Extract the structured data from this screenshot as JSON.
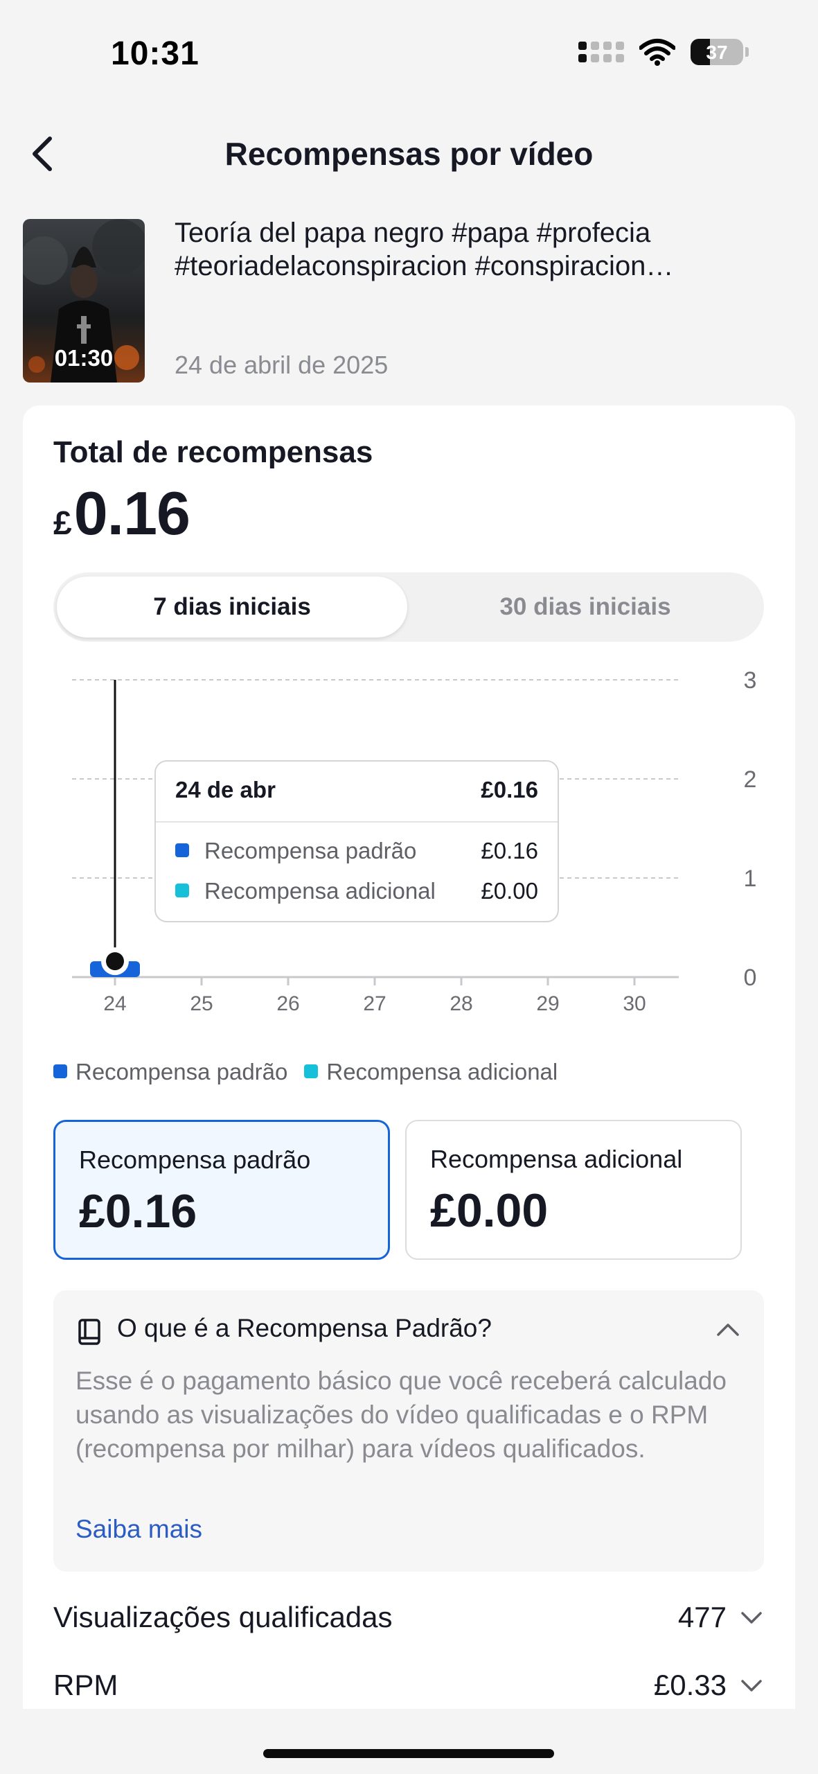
{
  "status_bar": {
    "time": "10:31",
    "battery": "37",
    "battery_level": 0.37
  },
  "header": {
    "title": "Recompensas por vídeo"
  },
  "video": {
    "duration": "01:30",
    "title": "Teoría del papa negro #papa #profecia #teoriadelaconspiracion #conspiracion…",
    "date": "24 de abril de 2025"
  },
  "total": {
    "label": "Total de recompensas",
    "currency": "£",
    "amount": "0.16"
  },
  "tabs": [
    {
      "label": "7 dias iniciais",
      "active": true
    },
    {
      "label": "30 dias iniciais",
      "active": false
    }
  ],
  "chart_data": {
    "type": "bar",
    "categories": [
      "24",
      "25",
      "26",
      "27",
      "28",
      "29",
      "30"
    ],
    "series": [
      {
        "name": "Recompensa padrão",
        "color": "#1664d9",
        "values": [
          0.16,
          0,
          0,
          0,
          0,
          0,
          0
        ]
      },
      {
        "name": "Recompensa adicional",
        "color": "#17c0d9",
        "values": [
          0.0,
          0,
          0,
          0,
          0,
          0,
          0
        ]
      }
    ],
    "ylim": [
      0,
      3
    ],
    "yticks": [
      "0",
      "1",
      "2",
      "3"
    ],
    "grid": true,
    "selected_category": "24"
  },
  "tooltip": {
    "date": "24 de abr",
    "total": "£0.16",
    "rows": [
      {
        "label": "Recompensa padrão",
        "value": "£0.16",
        "color": "#1664d9"
      },
      {
        "label": "Recompensa adicional",
        "value": "£0.00",
        "color": "#17c0d9"
      }
    ]
  },
  "legend": [
    {
      "label": "Recompensa padrão",
      "color": "#1664d9"
    },
    {
      "label": "Recompensa adicional",
      "color": "#17c0d9"
    }
  ],
  "boxes": [
    {
      "label": "Recompensa padrão",
      "value": "£0.16",
      "selected": true
    },
    {
      "label": "Recompensa adicional",
      "value": "£0.00",
      "selected": false
    }
  ],
  "info": {
    "title": "O que é a Recompensa Padrão?",
    "body": "Esse é o pagamento básico que você receberá calculado usando as visualizações do vídeo qualificadas e o RPM (recompensa por milhar) para vídeos qualificados.",
    "link": "Saiba mais"
  },
  "metrics": [
    {
      "label": "Visualizações qualificadas",
      "value": "477"
    },
    {
      "label": "RPM",
      "value": "£0.33"
    }
  ]
}
